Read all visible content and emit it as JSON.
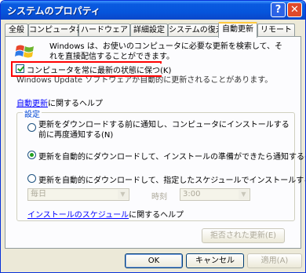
{
  "window": {
    "title": "システムのプロパティ",
    "help_glyph": "?",
    "close_glyph": "✕"
  },
  "tabs": [
    {
      "label": "全般"
    },
    {
      "label": "コンピュータ名"
    },
    {
      "label": "ハードウェア"
    },
    {
      "label": "詳細設定"
    },
    {
      "label": "システムの復元"
    },
    {
      "label": "自動更新",
      "active": true
    },
    {
      "label": "リモート"
    }
  ],
  "intro": {
    "text": "Windows は、お使いのコンピュータに必要な更新を検索して、それを直接配信することができます。"
  },
  "keep_current": {
    "label": "コンピュータを常に最新の状態に保つ(K)",
    "checked": true
  },
  "keep_current_hint": "Windows Update ソフトウェアが自動的に更新されることがあります。",
  "help_link": {
    "link": "自動更新",
    "text": "に関するヘルプ"
  },
  "settings": {
    "legend": "設定",
    "options": [
      {
        "label": "更新をダウンロードする前に通知し、コンピュータにインストールする前に再度通知する(N)",
        "selected": false
      },
      {
        "label": "更新を自動的にダウンロードして、インストールの準備ができたら通知する(D)",
        "selected": true
      },
      {
        "label": "更新を自動的にダウンロードして、指定したスケジュールでインストールする(U)",
        "selected": false
      }
    ],
    "day_value": "毎日",
    "time_label": "時刻",
    "time_value": "3:00",
    "schedule_link": "インストールのスケジュール",
    "schedule_link_suffix": "に関するヘルプ",
    "declined_button": "拒否された更新(E)"
  },
  "footer": {
    "ok": "OK",
    "cancel": "キャンセル",
    "apply": "適用(A)"
  },
  "colors": {
    "accent": "#0a5ae0",
    "highlight": "#ff0000",
    "link": "#0000ff"
  }
}
